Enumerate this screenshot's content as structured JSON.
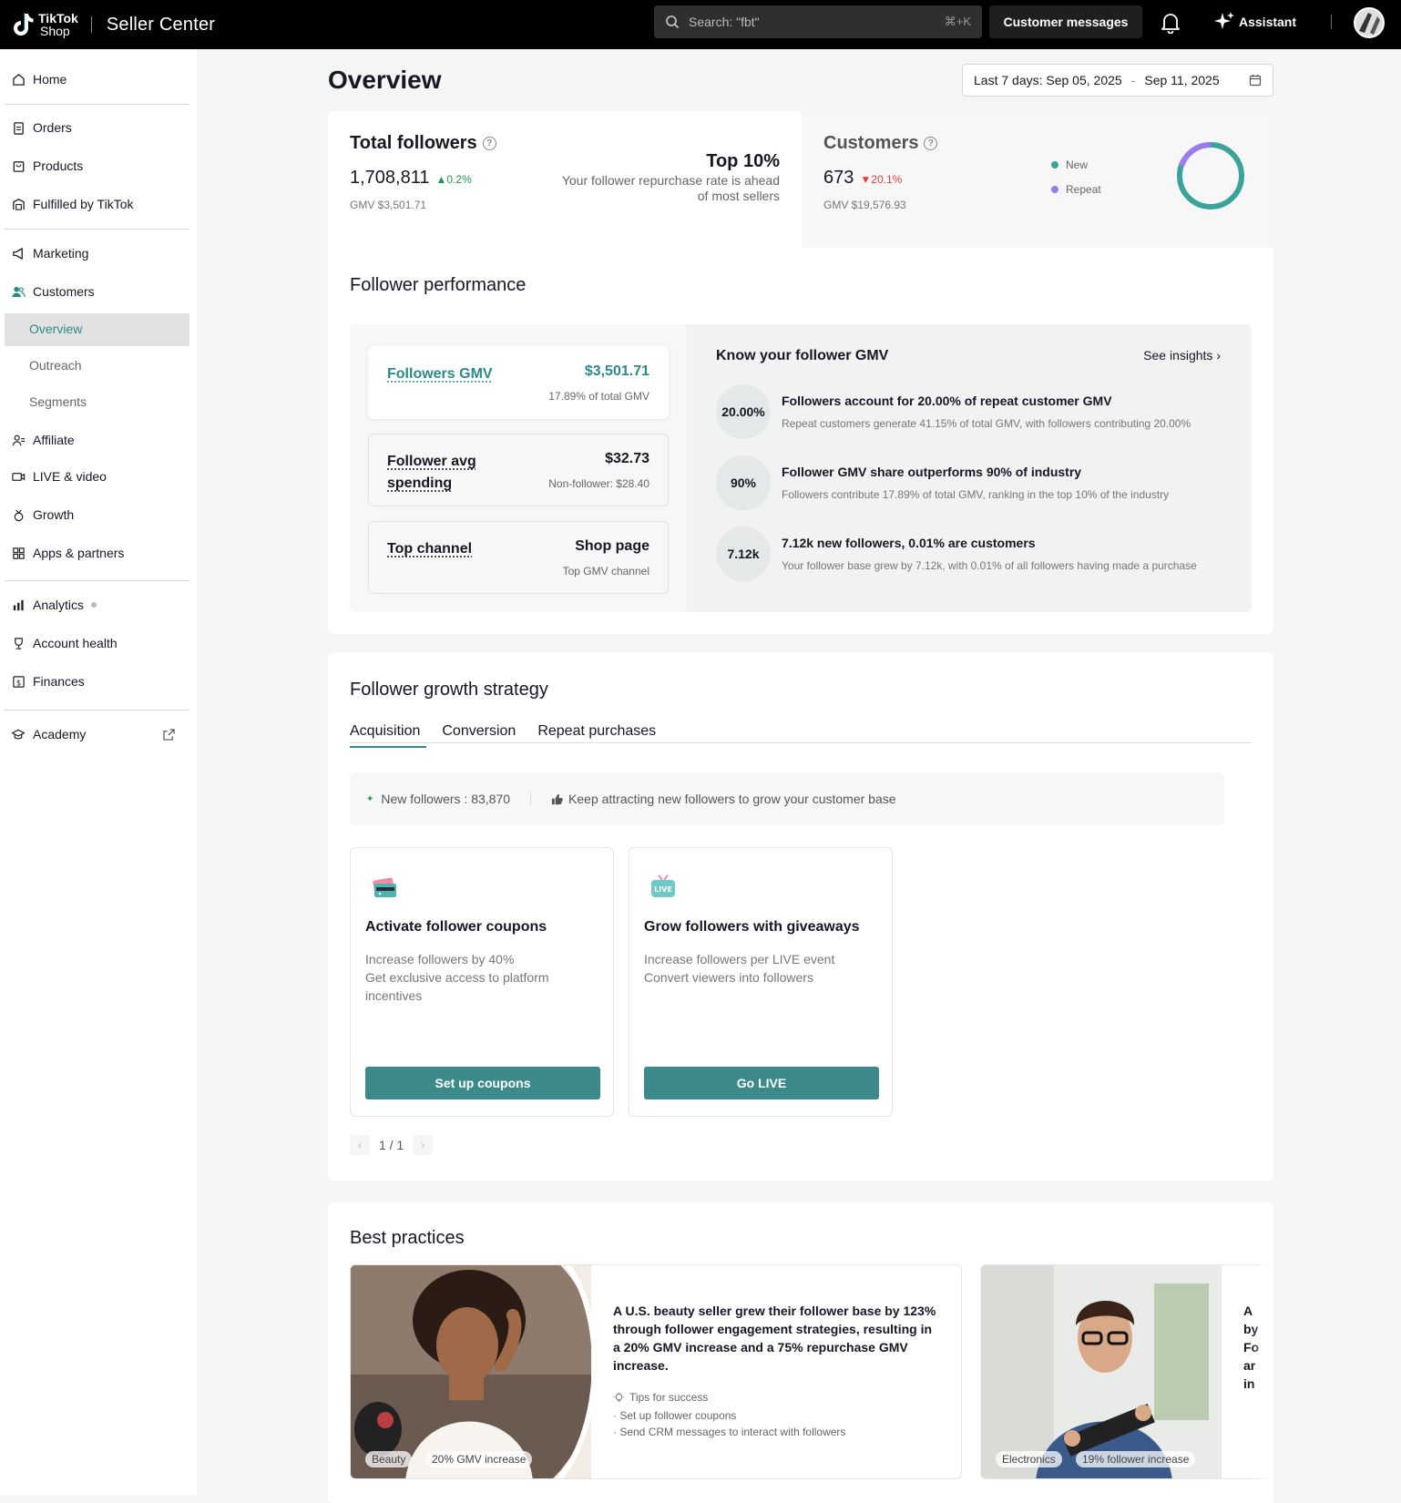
{
  "topbar": {
    "logo_line1": "TikTok",
    "logo_line2": "Shop",
    "app_name": "Seller Center",
    "search_placeholder": "Search: \"fbt\"",
    "search_shortcut": "⌘+K",
    "customer_messages": "Customer messages",
    "assistant": "Assistant"
  },
  "sidebar": {
    "home": "Home",
    "orders": "Orders",
    "products": "Products",
    "fbt": "Fulfilled by TikTok",
    "marketing": "Marketing",
    "customers": "Customers",
    "customers_sub": [
      "Overview",
      "Outreach",
      "Segments"
    ],
    "affiliate": "Affiliate",
    "live_video": "LIVE & video",
    "growth": "Growth",
    "apps": "Apps & partners",
    "analytics": "Analytics",
    "account_health": "Account health",
    "finances": "Finances",
    "academy": "Academy"
  },
  "page": {
    "title": "Overview",
    "date_range": {
      "label": "Last 7 days: Sep 05, 2025",
      "separator": "-",
      "end": "Sep 11, 2025"
    }
  },
  "summary": {
    "followers": {
      "title": "Total followers",
      "value": "1,708,811",
      "delta": "0.2%",
      "gmv": "GMV $3,501.71"
    },
    "top": {
      "big": "Top 10%",
      "line1": "Your follower repurchase rate is ahead",
      "line2": "of most sellers"
    },
    "customers": {
      "title": "Customers",
      "value": "673",
      "delta": "20.1%",
      "gmv": "GMV $19,576.93",
      "legend_new": "New",
      "legend_repeat": "Repeat"
    }
  },
  "performance": {
    "title": "Follower performance",
    "metrics": [
      {
        "label": "Followers GMV",
        "value": "$3,501.71",
        "sub": "17.89% of total GMV"
      },
      {
        "label": "Follower avg spending",
        "value": "$32.73",
        "sub": "Non-follower: $28.40"
      },
      {
        "label": "Top channel",
        "value": "Shop page",
        "sub": "Top GMV channel"
      }
    ],
    "insights_title": "Know your follower GMV",
    "see_insights": "See insights",
    "insights": [
      {
        "badge": "20.00%",
        "title": "Followers account for 20.00% of repeat customer GMV",
        "sub": "Repeat customers generate 41.15% of total GMV, with followers contributing 20.00%"
      },
      {
        "badge": "90%",
        "title": "Follower GMV share outperforms 90% of industry",
        "sub": "Followers contribute 17.89% of total GMV, ranking in the top 10% of the industry"
      },
      {
        "badge": "7.12k",
        "title": "7.12k new followers, 0.01% are customers",
        "sub": "Your follower base grew by 7.12k, with 0.01% of all followers having made a purchase"
      }
    ]
  },
  "growth": {
    "title": "Follower growth strategy",
    "tabs": [
      "Acquisition",
      "Conversion",
      "Repeat purchases"
    ],
    "banner_stat": "New followers : 83,870",
    "banner_tip": "Keep attracting new followers to grow your customer base",
    "cards": [
      {
        "title": "Activate follower coupons",
        "desc1": "Increase followers by 40%",
        "desc2": "Get exclusive access to platform incentives",
        "button": "Set up coupons"
      },
      {
        "title": "Grow followers with giveaways",
        "desc1": "Increase followers per LIVE event",
        "desc2": "Convert viewers into followers",
        "button": "Go LIVE"
      }
    ],
    "pager": "1 / 1"
  },
  "best_practices": {
    "title": "Best practices",
    "items": [
      {
        "tag1": "Beauty",
        "tag2": "20% GMV increase",
        "text": "A U.S. beauty seller grew their follower base by 123% through follower engagement strategies, resulting in a 20% GMV increase and a 75% repurchase GMV increase.",
        "tips_head": "Tips for success",
        "tip1": "· Set up follower coupons",
        "tip2": "· Send CRM messages to interact with followers"
      },
      {
        "tag1": "Electronics",
        "tag2": "19% follower increase",
        "text_partial": [
          "A",
          "by",
          "Fo",
          "ar",
          "in"
        ]
      }
    ]
  },
  "colors": {
    "accent": "#2c8a8a",
    "button": "#3d8a8a",
    "up": "#1a9b4b",
    "down": "#e13f3f",
    "donut_new": "#3aa39c",
    "donut_repeat": "#9b7cf0"
  }
}
